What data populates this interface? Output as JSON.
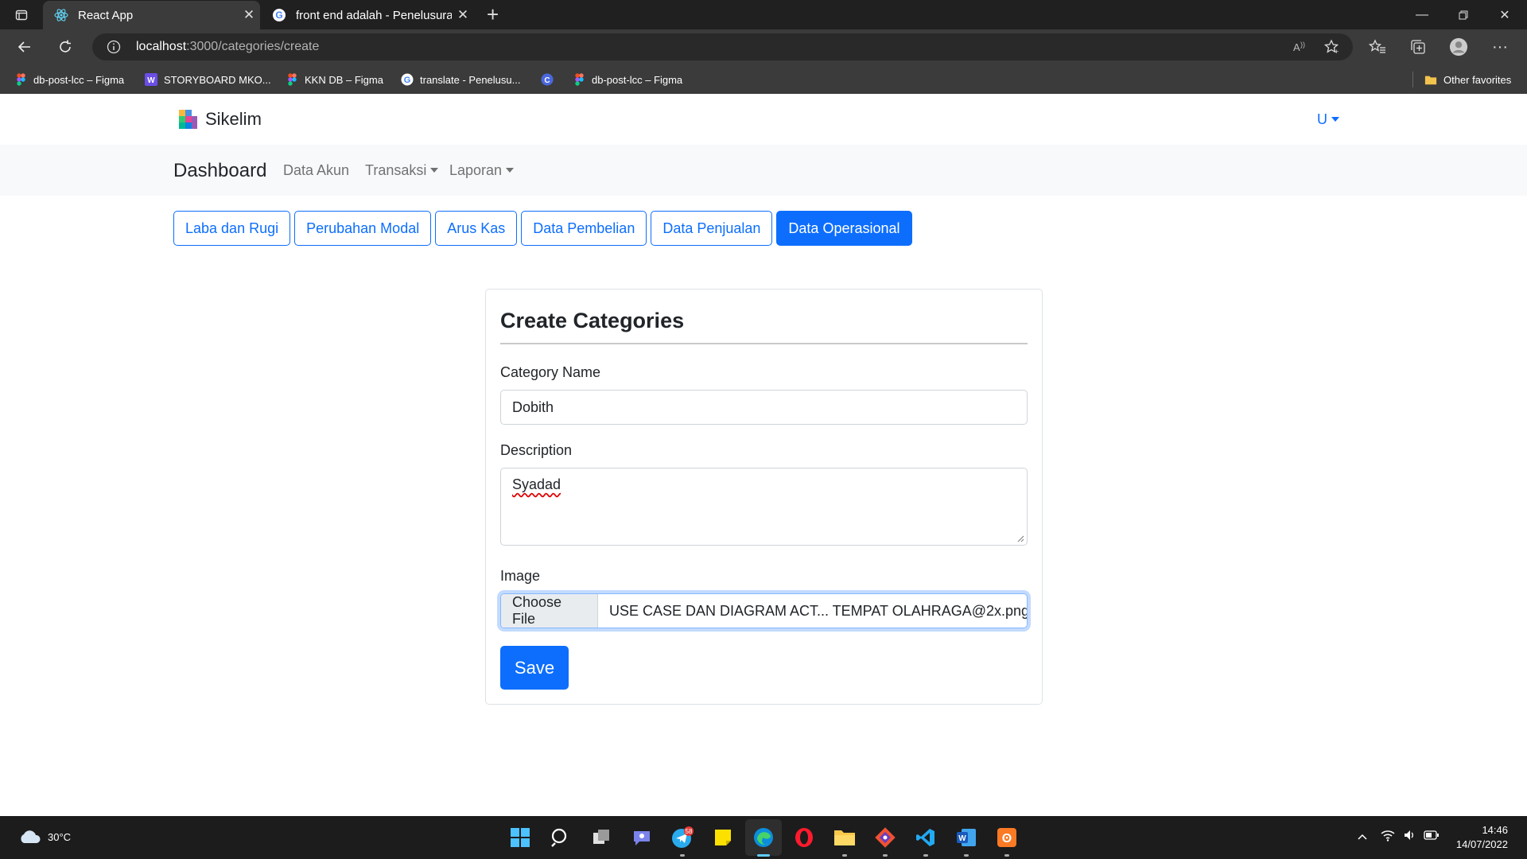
{
  "browser": {
    "tabs": [
      {
        "title": "React App",
        "active": true
      },
      {
        "title": "front end adalah - Penelusuran G",
        "active": false
      }
    ],
    "address": {
      "host": "localhost",
      "path": ":3000/categories/create"
    },
    "bookmarks": [
      {
        "label": "db-post-lcc – Figma",
        "icon": "figma-icon"
      },
      {
        "label": "STORYBOARD MKO...",
        "icon": "word-icon"
      },
      {
        "label": "KKN DB – Figma",
        "icon": "figma-icon"
      },
      {
        "label": "translate - Penelusu...",
        "icon": "google-icon"
      },
      {
        "label": "",
        "icon": "canva-icon"
      },
      {
        "label": "db-post-lcc – Figma",
        "icon": "figma-icon"
      }
    ],
    "other_favorites": "Other favorites"
  },
  "app": {
    "brand": "Sikelim",
    "user_menu": "U",
    "subnav": {
      "brand": "Dashboard",
      "links": [
        "Data Akun",
        "Transaksi",
        "Laporan"
      ]
    },
    "report_buttons": [
      {
        "label": "Laba dan Rugi",
        "active": false
      },
      {
        "label": "Perubahan Modal",
        "active": false
      },
      {
        "label": "Arus Kas",
        "active": false
      },
      {
        "label": "Data Pembelian",
        "active": false
      },
      {
        "label": "Data Penjualan",
        "active": false
      },
      {
        "label": "Data Operasional",
        "active": true
      }
    ]
  },
  "form": {
    "title": "Create Categories",
    "category_label": "Category Name",
    "category_value": "Dobith",
    "description_label": "Description",
    "description_value": "Syadad",
    "image_label": "Image",
    "choose_file": "Choose File",
    "file_name": "USE CASE DAN DIAGRAM ACT... TEMPAT OLAHRAGA@2x.png",
    "save": "Save"
  },
  "taskbar": {
    "weather": "30°C",
    "time": "14:46",
    "date": "14/07/2022",
    "telegram_badge": "58"
  },
  "colors": {
    "primary": "#0d6efd",
    "chrome_dark": "#202020",
    "chrome_mid": "#3b3b3b",
    "taskbar": "#1c1c1c"
  }
}
